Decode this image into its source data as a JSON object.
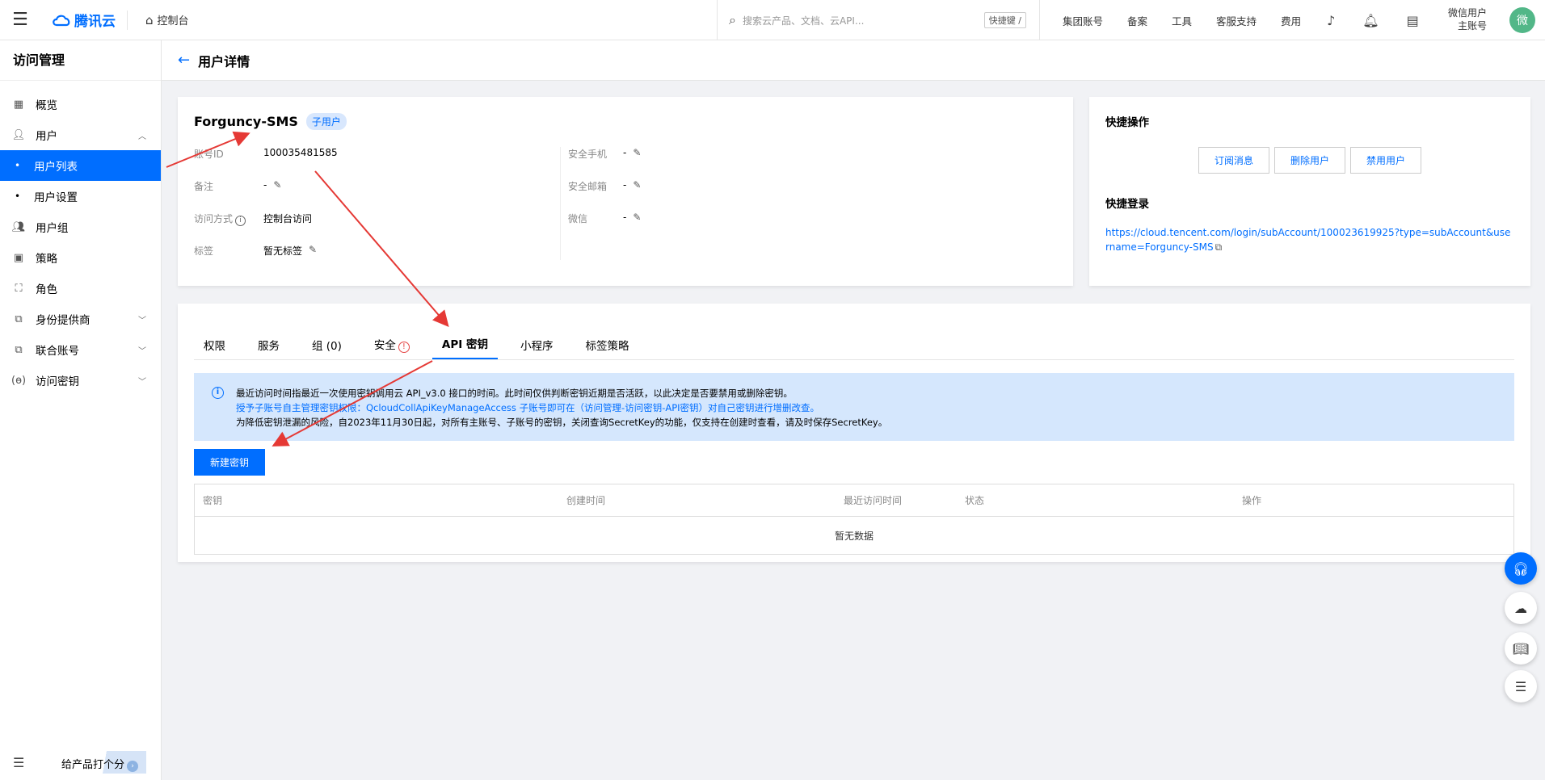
{
  "topbar": {
    "brand": "腾讯云",
    "console": "控制台",
    "search_placeholder": "搜索云产品、文档、云API...",
    "shortcut": "快捷键 /",
    "nav": [
      "集团账号",
      "备案",
      "工具",
      "客服支持",
      "费用"
    ],
    "user_line1": "微信用户",
    "user_line2": "主账号",
    "avatar": "微"
  },
  "sidebar": {
    "title": "访问管理",
    "items": [
      {
        "label": "概览"
      },
      {
        "label": "用户"
      },
      {
        "label": "用户列表"
      },
      {
        "label": "用户设置"
      },
      {
        "label": "用户组"
      },
      {
        "label": "策略"
      },
      {
        "label": "角色"
      },
      {
        "label": "身份提供商"
      },
      {
        "label": "联合账号"
      },
      {
        "label": "访问密钥"
      }
    ],
    "rate": "给产品打个分"
  },
  "header": {
    "title": "用户详情"
  },
  "user": {
    "name": "Forguncy-SMS",
    "tag": "子用户",
    "fields": {
      "account_id_label": "账号ID",
      "account_id": "100035481585",
      "remark_label": "备注",
      "remark": "-",
      "access_label": "访问方式",
      "access": "控制台访问",
      "tags_label": "标签",
      "tags": "暂无标签",
      "phone_label": "安全手机",
      "phone": "-",
      "email_label": "安全邮箱",
      "email": "-",
      "wechat_label": "微信",
      "wechat": "-"
    }
  },
  "quick": {
    "title": "快捷操作",
    "buttons": [
      "订阅消息",
      "删除用户",
      "禁用用户"
    ],
    "login_title": "快捷登录",
    "login_url": "https://cloud.tencent.com/login/subAccount/100023619925?type=subAccount&username=Forguncy-SMS"
  },
  "tabs": [
    "权限",
    "服务",
    "组 (0)",
    "安全",
    "API 密钥",
    "小程序",
    "标签策略"
  ],
  "notice": {
    "line1": "最近访问时间指最近一次使用密钥调用云 API_v3.0 接口的时间。此时间仅供判断密钥近期是否活跃，以此决定是否要禁用或删除密钥。",
    "line2": "授予子账号自主管理密钥权限：QcloudCollApiKeyManageAccess 子账号即可在（访问管理-访问密钥-API密钥）对自己密钥进行增删改查。",
    "line3": "为降低密钥泄漏的风险，自2023年11月30日起，对所有主账号、子账号的密钥，关闭查询SecretKey的功能，仅支持在创建时查看，请及时保存SecretKey。"
  },
  "new_key_button": "新建密钥",
  "table": {
    "headers": [
      "密钥",
      "创建时间",
      "最近访问时间",
      "状态",
      "操作"
    ],
    "empty": "暂无数据"
  },
  "colors": {
    "accent": "#006eff",
    "annotation": "#e53935"
  }
}
